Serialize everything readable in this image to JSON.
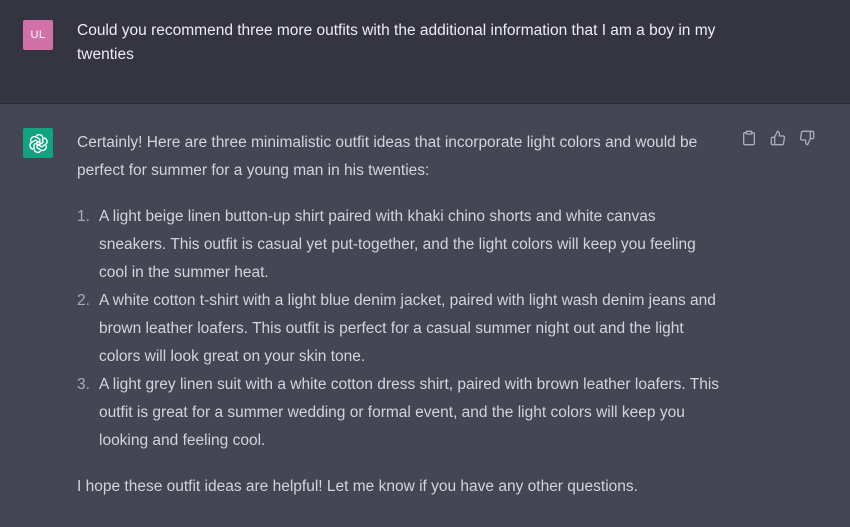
{
  "user_message": {
    "avatar_initials": "UL",
    "text": "Could you recommend three more outfits with the additional information that I am a boy in my twenties"
  },
  "assistant_message": {
    "intro": "Certainly! Here are three minimalistic outfit ideas that incorporate light colors and would be perfect for summer for a young man in his twenties:",
    "items": [
      {
        "number": "1.",
        "text": "A light beige linen button-up shirt paired with khaki chino shorts and white canvas sneakers. This outfit is casual yet put-together, and the light colors will keep you feeling cool in the summer heat."
      },
      {
        "number": "2.",
        "text": "A white cotton t-shirt with a light blue denim jacket, paired with light wash denim jeans and brown leather loafers. This outfit is perfect for a casual summer night out and the light colors will look great on your skin tone."
      },
      {
        "number": "3.",
        "text": "A light grey linen suit with a white cotton dress shirt, paired with brown leather loafers. This outfit is great for a summer wedding or formal event, and the light colors will keep you looking and feeling cool."
      }
    ],
    "outro": "I hope these outfit ideas are helpful! Let me know if you have any other questions."
  },
  "actions": {
    "icons": [
      "clipboard-icon",
      "thumbs-up-icon",
      "thumbs-down-icon"
    ]
  },
  "colors": {
    "user_bg": "#343541",
    "assistant_bg": "#444654",
    "user_avatar": "#d271a8",
    "assistant_avatar": "#10a37f"
  }
}
